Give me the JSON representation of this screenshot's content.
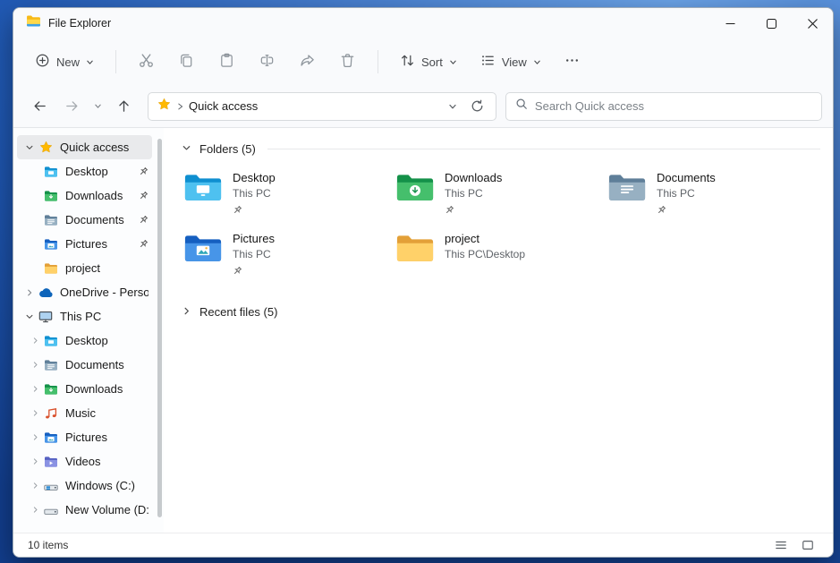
{
  "window": {
    "title": "File Explorer"
  },
  "toolbar": {
    "new_label": "New",
    "sort_label": "Sort",
    "view_label": "View"
  },
  "navbar": {
    "location": "Quick access",
    "search_placeholder": "Search Quick access"
  },
  "sidebar": {
    "items": [
      {
        "label": "Quick access"
      },
      {
        "label": "Desktop"
      },
      {
        "label": "Downloads"
      },
      {
        "label": "Documents"
      },
      {
        "label": "Pictures"
      },
      {
        "label": "project"
      },
      {
        "label": "OneDrive - Person"
      },
      {
        "label": "This PC"
      },
      {
        "label": "Desktop"
      },
      {
        "label": "Documents"
      },
      {
        "label": "Downloads"
      },
      {
        "label": "Music"
      },
      {
        "label": "Pictures"
      },
      {
        "label": "Videos"
      },
      {
        "label": "Windows (C:)"
      },
      {
        "label": "New Volume (D:"
      }
    ]
  },
  "content": {
    "folders_header": "Folders (5)",
    "recent_header": "Recent files (5)",
    "folders": [
      {
        "name": "Desktop",
        "location": "This PC"
      },
      {
        "name": "Downloads",
        "location": "This PC"
      },
      {
        "name": "Documents",
        "location": "This PC"
      },
      {
        "name": "Pictures",
        "location": "This PC"
      },
      {
        "name": "project",
        "location": "This PC\\Desktop"
      }
    ]
  },
  "statusbar": {
    "count": "10 items"
  },
  "colors": {
    "accent": "#0067c0",
    "folder_yellow": "#ffd169",
    "selection": "#e9eaec",
    "wallpaper_blue": "#2059b4"
  }
}
